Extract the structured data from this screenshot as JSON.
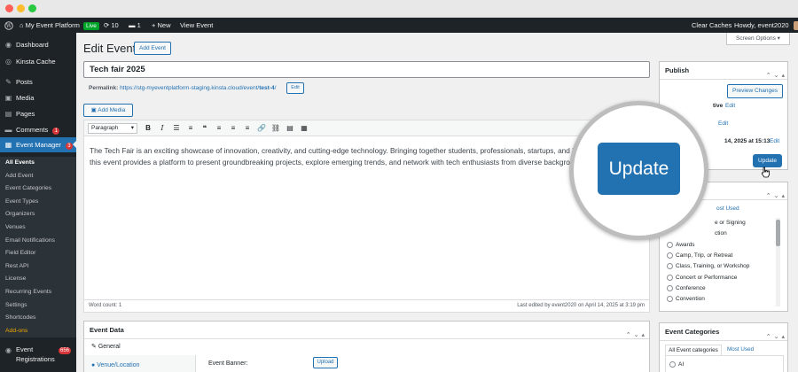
{
  "adminbar": {
    "site_name": "My Event Platform",
    "live_badge": "Live",
    "updates_count": "10",
    "comments_count": "1",
    "new_label": "New",
    "view_event": "View Event",
    "clear_caches": "Clear Caches",
    "howdy": "Howdy, event2020"
  },
  "sidebar": {
    "dashboard": "Dashboard",
    "kinsta": "Kinsta Cache",
    "posts": "Posts",
    "media": "Media",
    "pages": "Pages",
    "comments": "Comments",
    "comments_badge": "1",
    "event_manager": "Event Manager",
    "event_manager_badge": "3",
    "submenu": [
      "All Events",
      "Add Event",
      "Event Categories",
      "Event Types",
      "Organizers",
      "Venues",
      "Email Notifications",
      "Field Editor",
      "Rest API",
      "License",
      "Recurring Events",
      "Settings",
      "Shortcodes",
      "Add-ons"
    ],
    "registrations": "Event Registrations",
    "registrations_badge": "656"
  },
  "main": {
    "screen_options": "Screen Options",
    "title": "Edit Event",
    "add_event": "Add Event",
    "event_title": "Tech fair 2025",
    "permalink_label": "Permalink:",
    "permalink_url": "https://stg-myeventplatform-staging.kinsta.cloud/event/",
    "permalink_slug": "test-4",
    "permalink_end": "/",
    "edit": "Edit",
    "add_media": "Add Media",
    "format": "Paragraph",
    "content": "The Tech Fair is an exciting showcase of innovation, creativity, and cutting-edge technology. Bringing together students, professionals, startups, and industry leaders, this event provides a platform to present groundbreaking projects, explore emerging trends, and network with tech enthusiasts from diverse backgrounds.",
    "word_count": "Word count: 1",
    "last_edited": "Last edited by event2020 on April 14, 2025 at 3:19 pm"
  },
  "event_data": {
    "title": "Event Data",
    "tab_general": "General",
    "tab_venue": "Venue/Location",
    "banner_label": "Event Banner:",
    "upload": "Upload"
  },
  "publish": {
    "title": "Publish",
    "preview": "Preview Changes",
    "status_fragment": "tive",
    "edit1": "Edit",
    "edit2": "Edit",
    "date_fragment": "14, 2025 at 15:13",
    "edit3": "Edit",
    "update": "Update"
  },
  "event_types_box": {
    "most_used_fragment": "ost Used",
    "items": [
      "e or Signing",
      "ction",
      "Awards",
      "Camp, Trip, or Retreat",
      "Class, Training, or Workshop",
      "Concert or Performance",
      "Conference",
      "Convention"
    ]
  },
  "event_categories": {
    "title": "Event Categories",
    "tab_all": "All Event categories",
    "tab_most": "Most Used",
    "first_item": "AI"
  },
  "magnifier": {
    "update": "Update"
  }
}
